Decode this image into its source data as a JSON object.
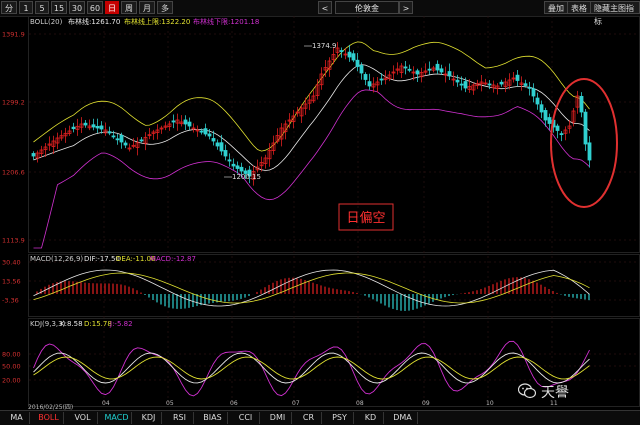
{
  "toolbar": {
    "periods": [
      "分",
      "1",
      "5",
      "15",
      "30",
      "60",
      "日",
      "周",
      "月",
      "多"
    ],
    "active_period": "日",
    "symbol": "伦敦金",
    "prev_arrow": "<",
    "next_arrow": ">",
    "overlay_label": "叠加",
    "table_label": "表格",
    "hide_indicator_label": "隐藏主图指标"
  },
  "main_chart": {
    "indicator_label": "BOLL(20)",
    "mid_label": "布林线:1261.70",
    "upper_label": "布林线上限:1322.20",
    "lower_label": "布林线下限:1201.18",
    "y_ticks": [
      "1391.9",
      "1299.2",
      "1206.6",
      "1113.9"
    ],
    "high_annotation": "1374.9",
    "low_annotation": "1200.15",
    "note_box": "日偏空"
  },
  "macd_panel": {
    "label": "MACD(12,26,9)",
    "dif": "DIF:-17.50",
    "dea": "DEA:-11.06",
    "macd": "MACD:-12.87",
    "y_ticks": [
      "30.40",
      "13.56",
      "-3.36"
    ]
  },
  "kdj_panel": {
    "label": "KDJ(9,3,3)",
    "k": "K:8.58",
    "d": "D:15.78",
    "j": "J:-5.82",
    "y_ticks": [
      "80.00",
      "50.00",
      "20.00"
    ]
  },
  "x_axis": {
    "start_date": "2016/02/25(四)",
    "month_ticks": [
      "04",
      "05",
      "06",
      "07",
      "08",
      "09",
      "10",
      "11"
    ]
  },
  "bottom_tabs": [
    "MA",
    "BOLL",
    "VOL",
    "MACD",
    "KDJ",
    "RSI",
    "BIAS",
    "CCI",
    "DMI",
    "CR",
    "PSY",
    "KD",
    "DMA"
  ],
  "watermark": "天譽",
  "colors": {
    "up": "#e02020",
    "down": "#30d0d0",
    "boll_mid": "#e8e8e8",
    "boll_upper": "#e0e030",
    "boll_lower": "#d030d0",
    "highlight_circle": "#e03030"
  }
}
